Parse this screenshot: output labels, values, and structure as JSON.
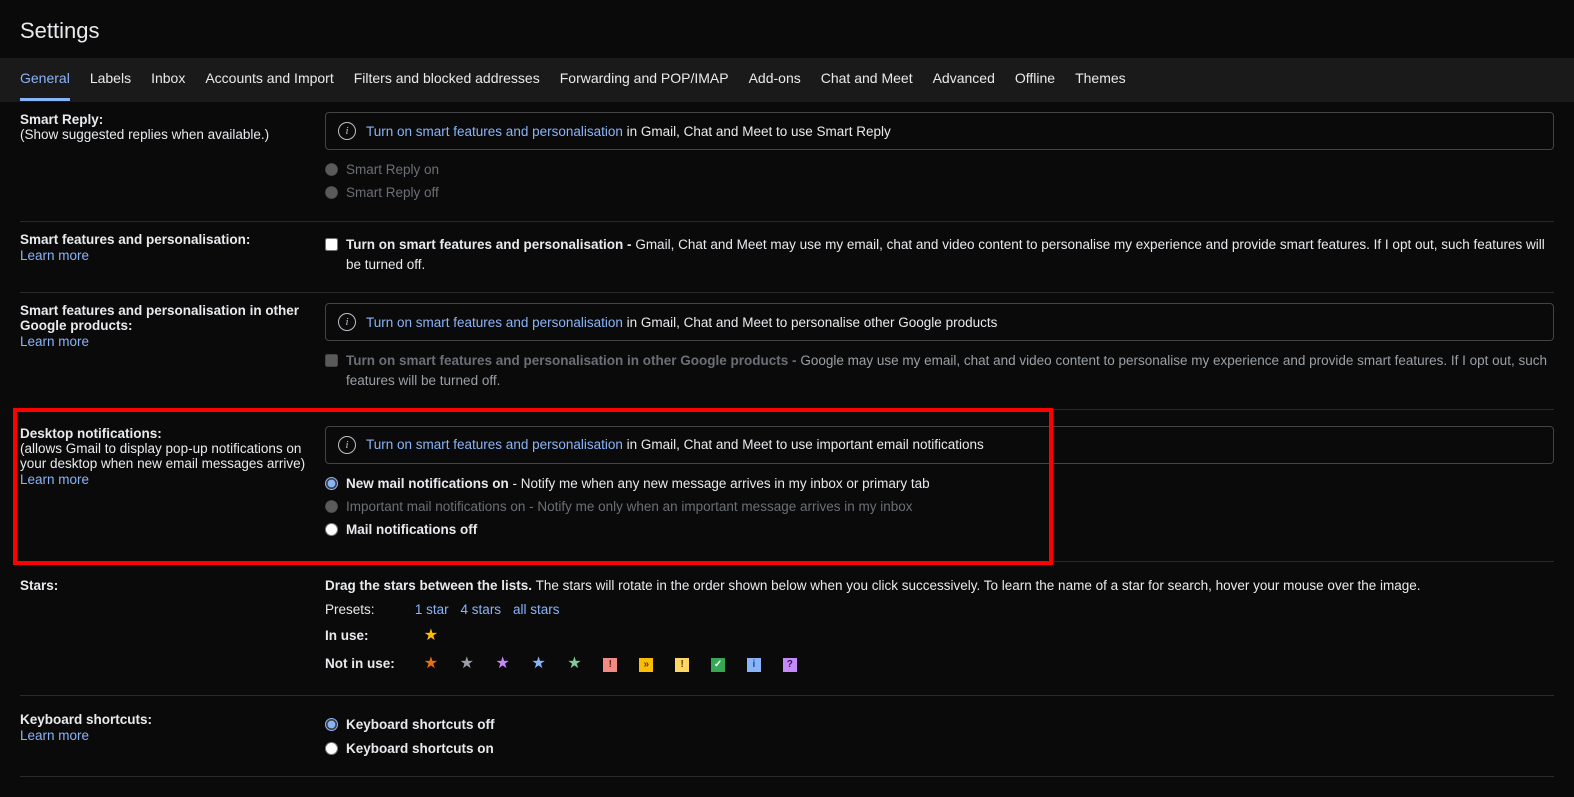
{
  "page_title": "Settings",
  "tabs": [
    "General",
    "Labels",
    "Inbox",
    "Accounts and Import",
    "Filters and blocked addresses",
    "Forwarding and POP/IMAP",
    "Add-ons",
    "Chat and Meet",
    "Advanced",
    "Offline",
    "Themes"
  ],
  "active_tab": 0,
  "link_turn_on": "Turn on smart features and personalisation",
  "learn_more": "Learn more",
  "smart_reply": {
    "title": "Smart Reply:",
    "sub": "(Show suggested replies when available.)",
    "banner_rest": " in Gmail, Chat and Meet to use Smart Reply",
    "opt_on": "Smart Reply on",
    "opt_off": "Smart Reply off"
  },
  "smart_features": {
    "title": "Smart features and personalisation:",
    "check_label": "Turn on smart features and personalisation - ",
    "check_desc": "Gmail, Chat and Meet may use my email, chat and video content to personalise my experience and provide smart features. If I opt out, such features will be turned off."
  },
  "smart_other": {
    "title": "Smart features and personalisation in other Google products:",
    "banner_rest": " in Gmail, Chat and Meet to personalise other Google products",
    "check_label": "Turn on smart features and personalisation in other Google products - ",
    "check_desc": "Google may use my email, chat and video content to personalise my experience and provide smart features. If I opt out, such features will be turned off."
  },
  "desktop": {
    "title": "Desktop notifications:",
    "sub": "(allows Gmail to display pop-up notifications on your desktop when new email messages arrive)",
    "banner_rest": " in Gmail, Chat and Meet to use important email notifications",
    "opt1_b": "New mail notifications on",
    "opt1_r": " - Notify me when any new message arrives in my inbox or primary tab",
    "opt2_b": "Important mail notifications on",
    "opt2_r": " - Notify me only when an important message arrives in my inbox",
    "opt3_b": "Mail notifications off"
  },
  "stars": {
    "title": "Stars:",
    "intro_b": "Drag the stars between the lists.",
    "intro_r": "  The stars will rotate in the order shown below when you click successively. To learn the name of a star for search, hover your mouse over the image.",
    "presets_label": "Presets:",
    "preset1": "1 star",
    "preset2": "4 stars",
    "preset3": "all stars",
    "in_use": "In use:",
    "not_in_use": "Not in use:"
  },
  "kb": {
    "title": "Keyboard shortcuts:",
    "opt_off": "Keyboard shortcuts off",
    "opt_on": "Keyboard shortcuts on"
  }
}
